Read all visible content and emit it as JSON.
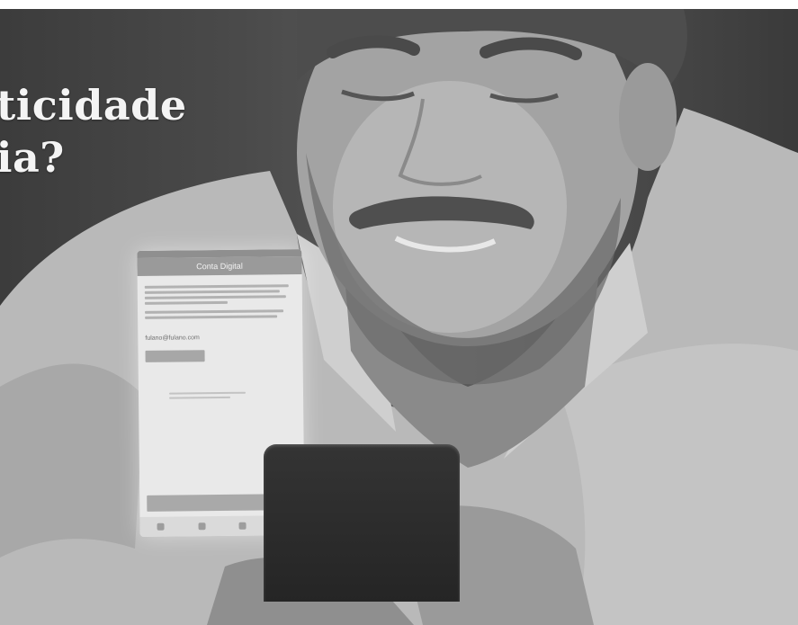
{
  "headline": {
    "line1": "ticidade",
    "line2": "ia?"
  },
  "app_screen": {
    "header_title": "Conta Digital",
    "field_value": "fulano@fulano.com"
  },
  "colors": {
    "background": "#4a4a4a",
    "headline_text": "#f4f4f4",
    "screen_glow": "#e9e9e9"
  }
}
